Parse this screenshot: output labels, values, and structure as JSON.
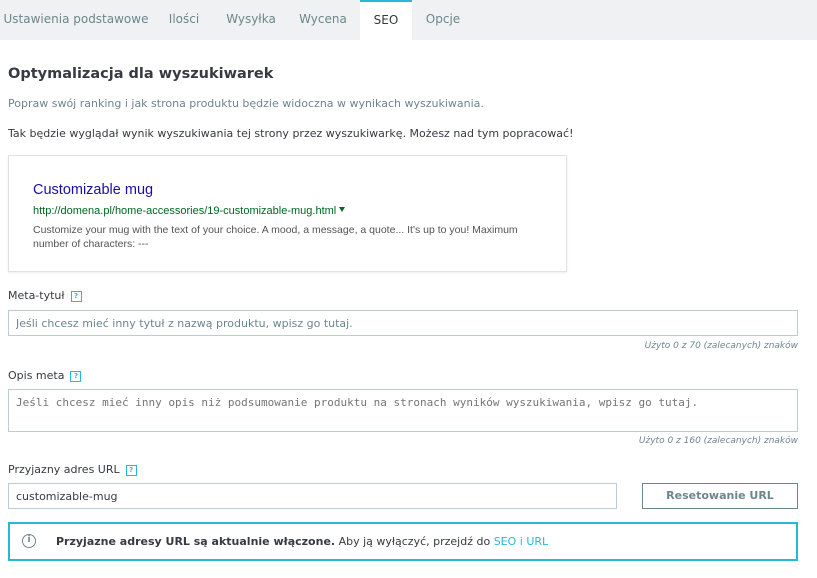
{
  "tabs": [
    {
      "label": "Ustawienia podstawowe"
    },
    {
      "label": "Ilości"
    },
    {
      "label": "Wysyłka"
    },
    {
      "label": "Wycena"
    },
    {
      "label": "SEO"
    },
    {
      "label": "Opcje"
    }
  ],
  "seo": {
    "title": "Optymalizacja dla wyszukiwarek",
    "subtitle": "Popraw swój ranking i jak strona produktu będzie widoczna w wynikach wyszukiwania.",
    "note": "Tak będzie wyglądał wynik wyszukiwania tej strony przez wyszukiwarkę. Możesz nad tym popracować!"
  },
  "preview": {
    "title": "Customizable mug",
    "url": "http://domena.pl/home-accessories/19-customizable-mug.html",
    "description": "Customize your mug with the text of your choice. A mood, a message, a quote... It's up to you! Maximum number of characters: ---"
  },
  "meta_title": {
    "label": "Meta-tytuł",
    "placeholder": "Jeśli chcesz mieć inny tytuł z nazwą produktu, wpisz go tutaj.",
    "counter": "Użyto 0 z 70 (zalecanych) znaków"
  },
  "meta_description": {
    "label": "Opis meta",
    "placeholder": "Jeśli chcesz mieć inny opis niż podsumowanie produktu na stronach wyników wyszukiwania, wpisz go tutaj.",
    "counter": "Użyto 0 z 160 (zalecanych) znaków"
  },
  "friendly_url": {
    "label": "Przyjazny adres URL",
    "value": "customizable-mug",
    "reset_label": "Resetowanie URL"
  },
  "help_glyph": "?",
  "alert": {
    "icon": "info-icon",
    "icon_glyph": "i",
    "bold": "Przyjazne adresy URL są aktualnie włączone.",
    "text": " Aby ją wyłączyć, przejdź do ",
    "link": "SEO i URL"
  },
  "colors": {
    "accent": "#25b9d7",
    "serp_title": "#1a0dab",
    "serp_url": "#006621"
  }
}
